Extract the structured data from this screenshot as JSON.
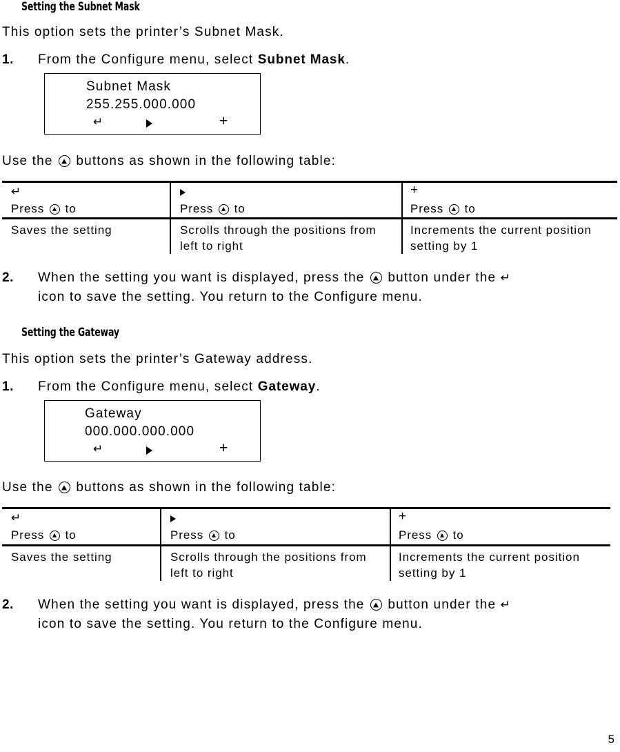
{
  "document": {
    "page_number": "5"
  },
  "sections": [
    {
      "heading": "Setting the Subnet Mask",
      "intro": "This option sets the printer’s Subnet Mask.",
      "step1": {
        "number": "1.",
        "text_before": "From the Configure menu, select ",
        "bold_term": "Subnet Mask",
        "text_after": "."
      },
      "lcd": {
        "line1": "Subnet Mask",
        "line2": "255.255.000.000",
        "icon_enter": "↵",
        "icon_right": "right-triangle",
        "icon_plus": "+"
      },
      "table_intro_before": "Use the ",
      "table_intro_after": " buttons as shown in the following table:",
      "table": {
        "headers": [
          {
            "icon": "↵",
            "icon_kind": "enter",
            "label": "Press",
            "label_after": "to"
          },
          {
            "icon": "▶",
            "icon_kind": "right",
            "label": "Press",
            "label_after": "to"
          },
          {
            "icon": "+",
            "icon_kind": "plus",
            "label": "Press",
            "label_after": "to"
          }
        ],
        "row": [
          "Saves the setting",
          "Scrolls through the positions from left to right",
          "Increments the current position setting by 1"
        ]
      },
      "step2": {
        "number": "2.",
        "line1_before": "When the setting you want is displayed, press the ",
        "line1_after": " button under the ",
        "line1_icon": "↵",
        "line2": "icon to save the setting.  You return to the Configure menu."
      }
    },
    {
      "heading": "Setting the Gateway",
      "intro": "This option sets the printer’s Gateway address.",
      "step1": {
        "number": "1.",
        "text_before": "From the Configure menu, select ",
        "bold_term": "Gateway",
        "text_after": "."
      },
      "lcd": {
        "line1": "Gateway",
        "line2": "000.000.000.000",
        "icon_enter": "↵",
        "icon_right": "right-triangle",
        "icon_plus": "+"
      },
      "table_intro_before": "Use the ",
      "table_intro_after": " buttons as shown in the following table:",
      "table": {
        "headers": [
          {
            "icon": "↵",
            "icon_kind": "enter",
            "label": "Press",
            "label_after": "to"
          },
          {
            "icon": "▶",
            "icon_kind": "right",
            "label": "Press",
            "label_after": "to"
          },
          {
            "icon": "+",
            "icon_kind": "plus",
            "label": "Press",
            "label_after": "to"
          }
        ],
        "row": [
          "Saves the setting",
          "Scrolls through the positions from left to right",
          "Increments the current position setting by 1"
        ]
      },
      "step2": {
        "number": "2.",
        "line1_before": "When the setting you want is displayed, press the ",
        "line1_after": " button under the ",
        "line1_icon": "↵",
        "line2": "icon to save the setting.  You return to the Configure menu."
      }
    }
  ]
}
